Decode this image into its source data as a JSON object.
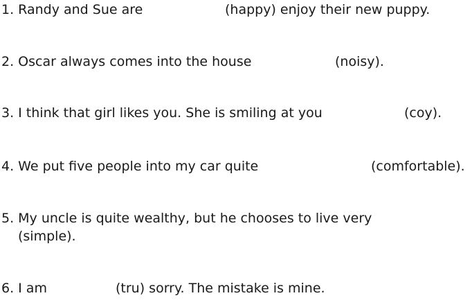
{
  "exercise": {
    "items": [
      {
        "prompt": "1. Randy and Sue are",
        "hint": "(happy) enjoy their new puppy."
      },
      {
        "prompt": "2. Oscar always comes into the house",
        "hint": "(noisy)."
      },
      {
        "prompt": "3. I think that girl likes you. She is smiling at you",
        "hint": "(coy)."
      },
      {
        "prompt": "4. We put five people into my car quite",
        "hint": "(comfortable)."
      },
      {
        "prompt": "5. My uncle is quite wealthy, but he chooses to live very",
        "hint": "(simple)."
      },
      {
        "prompt": "6. I am",
        "hint": "(tru) sorry. The mistake is mine."
      }
    ]
  }
}
